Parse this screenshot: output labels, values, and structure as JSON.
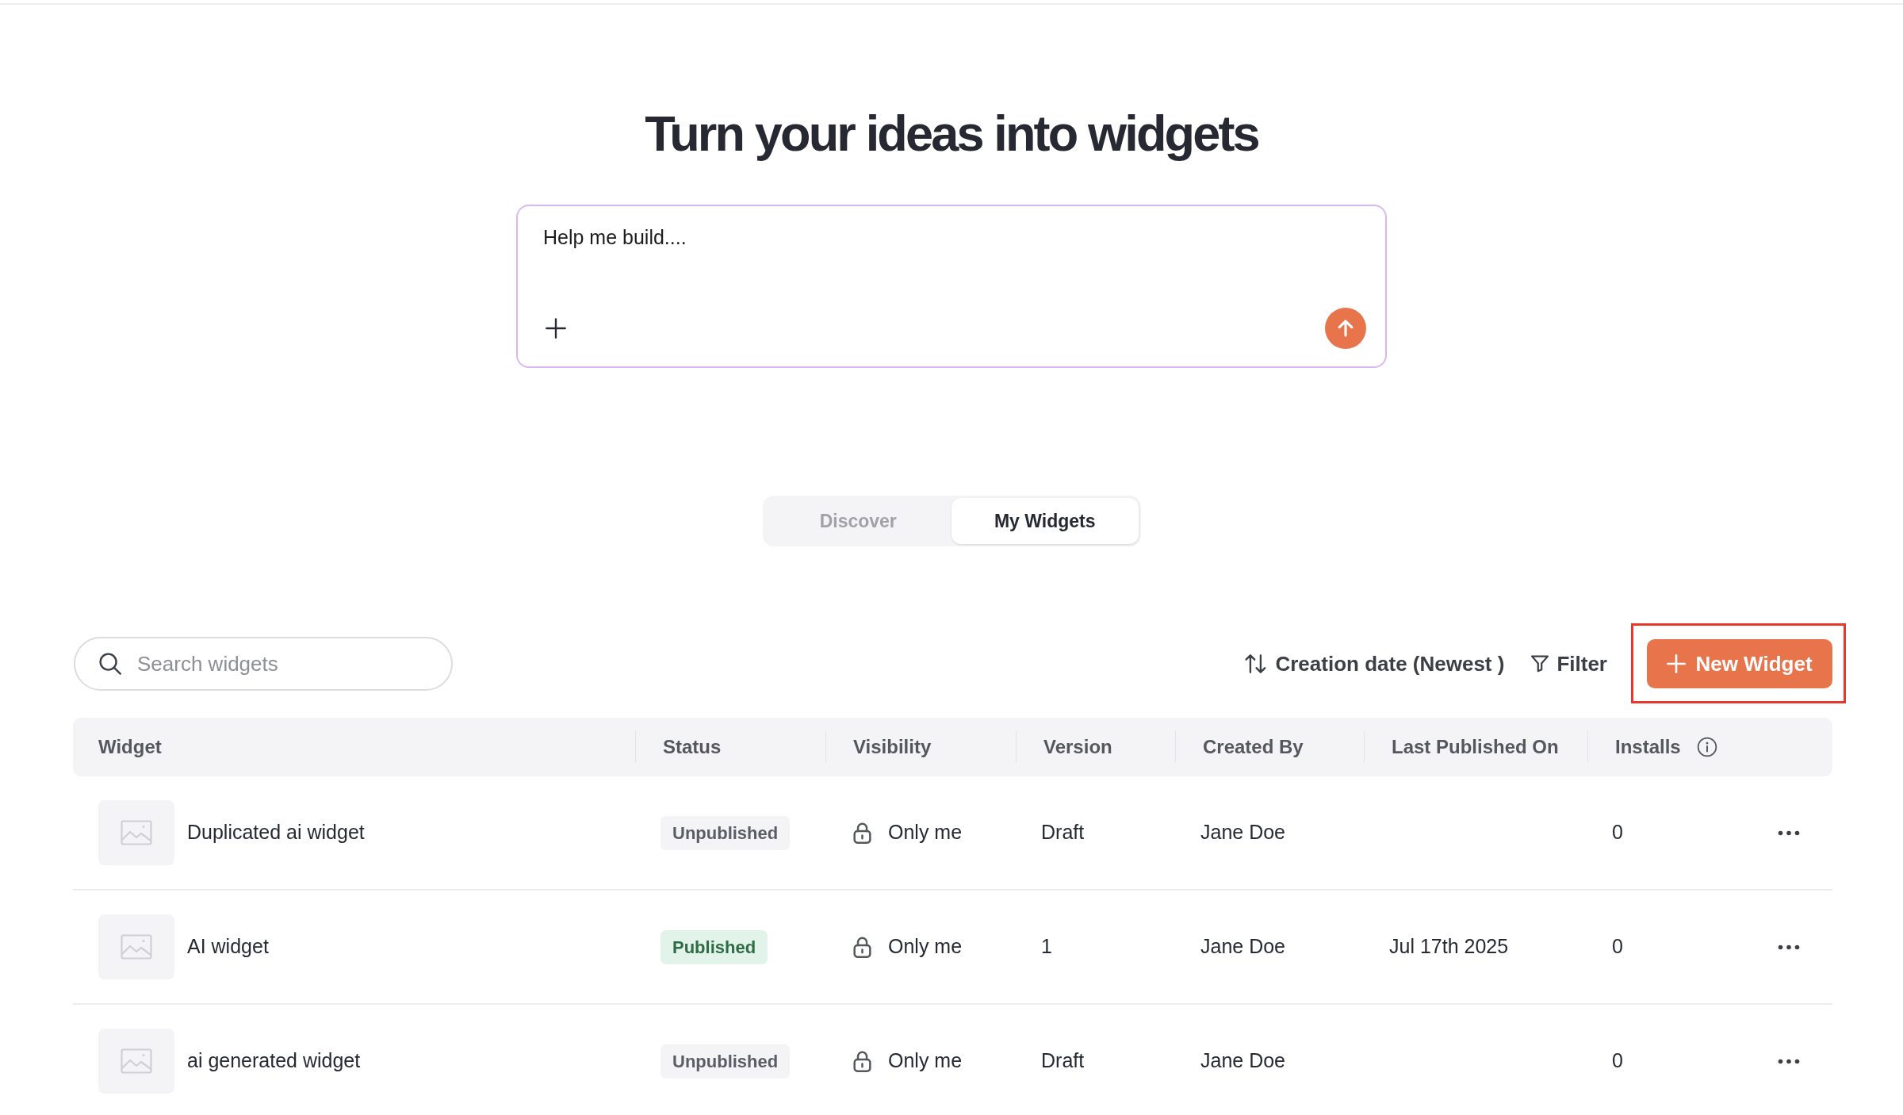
{
  "hero": {
    "title": "Turn your ideas into widgets"
  },
  "prompt": {
    "placeholder": "Help me build...."
  },
  "tabs": [
    {
      "label": "Discover",
      "selected": false
    },
    {
      "label": "My Widgets",
      "selected": true
    }
  ],
  "toolbar": {
    "search": {
      "placeholder": "Search widgets"
    },
    "sort": {
      "label": "Creation date (Newest )"
    },
    "filter": {
      "label": "Filter"
    },
    "new_widget_button": {
      "label": "New Widget",
      "highlighted": true
    }
  },
  "table": {
    "columns": [
      {
        "label": "Widget"
      },
      {
        "label": "Status"
      },
      {
        "label": "Visibility"
      },
      {
        "label": "Version"
      },
      {
        "label": "Created By"
      },
      {
        "label": "Last Published On"
      },
      {
        "label": "Installs",
        "info": true
      }
    ],
    "rows": [
      {
        "name": "Duplicated ai widget",
        "status": {
          "label": "Unpublished",
          "kind": "unpublished"
        },
        "visibility": "Only me",
        "version": "Draft",
        "created_by": "Jane Doe",
        "installs": "0"
      },
      {
        "name": "AI widget",
        "status": {
          "label": "Published",
          "kind": "published"
        },
        "visibility": "Only me",
        "version": "1",
        "created_by": "Jane Doe",
        "last_published_on": "Jul 17th 2025",
        "installs": "0"
      },
      {
        "name": "ai generated widget",
        "status": {
          "label": "Unpublished",
          "kind": "unpublished"
        },
        "visibility": "Only me",
        "version": "Draft",
        "created_by": "Jane Doe",
        "installs": "0"
      }
    ]
  }
}
